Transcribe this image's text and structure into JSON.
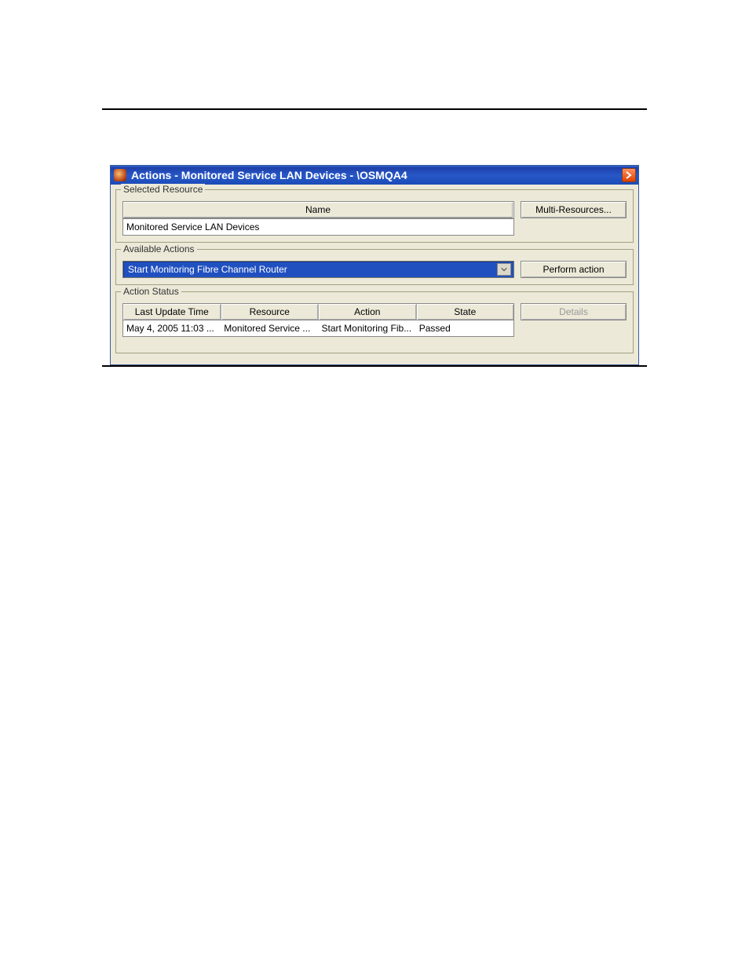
{
  "window": {
    "title": "Actions - Monitored Service LAN Devices - \\OSMQA4"
  },
  "selectedResource": {
    "legend": "Selected Resource",
    "nameHeader": "Name",
    "nameValue": "Monitored Service LAN Devices",
    "multiResourcesBtn": "Multi-Resources..."
  },
  "availableActions": {
    "legend": "Available Actions",
    "selected": "Start Monitoring Fibre Channel Router",
    "performBtn": "Perform action"
  },
  "actionStatus": {
    "legend": "Action Status",
    "headers": {
      "lastUpdate": "Last Update Time",
      "resource": "Resource",
      "action": "Action",
      "state": "State"
    },
    "row": {
      "lastUpdate": "May 4, 2005 11:03 ...",
      "resource": "Monitored Service ...",
      "action": "Start Monitoring Fib...",
      "state": "Passed"
    },
    "detailsBtn": "Details"
  }
}
